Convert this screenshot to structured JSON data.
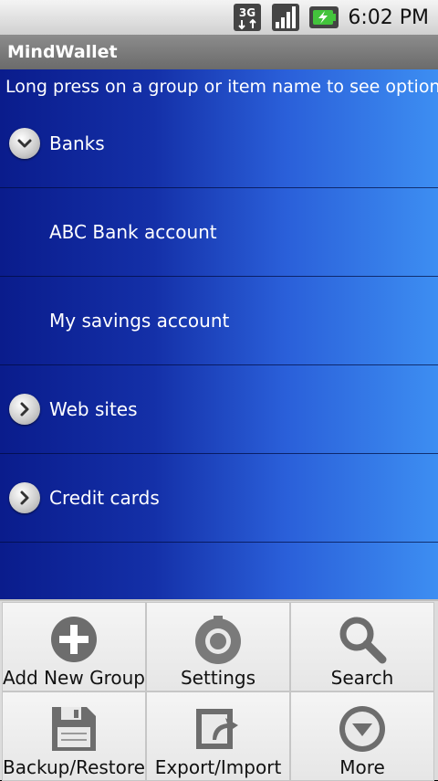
{
  "statusbar": {
    "network": "3G",
    "time": "6:02 PM"
  },
  "app": {
    "title": "MindWallet"
  },
  "hint": "Long press on a group or item name to see options.",
  "list": [
    {
      "label": "Banks",
      "type": "group",
      "expanded": true
    },
    {
      "label": "ABC Bank account",
      "type": "item"
    },
    {
      "label": "My savings account",
      "type": "item"
    },
    {
      "label": "Web sites",
      "type": "group",
      "expanded": false
    },
    {
      "label": "Credit cards",
      "type": "group",
      "expanded": false
    }
  ],
  "menu": [
    {
      "label": "Add New Group",
      "icon": "add-icon"
    },
    {
      "label": "Settings",
      "icon": "settings-icon"
    },
    {
      "label": "Search",
      "icon": "search-icon"
    },
    {
      "label": "Backup/Restore",
      "icon": "save-icon"
    },
    {
      "label": "Export/Import",
      "icon": "export-icon"
    },
    {
      "label": "More",
      "icon": "more-icon"
    }
  ]
}
